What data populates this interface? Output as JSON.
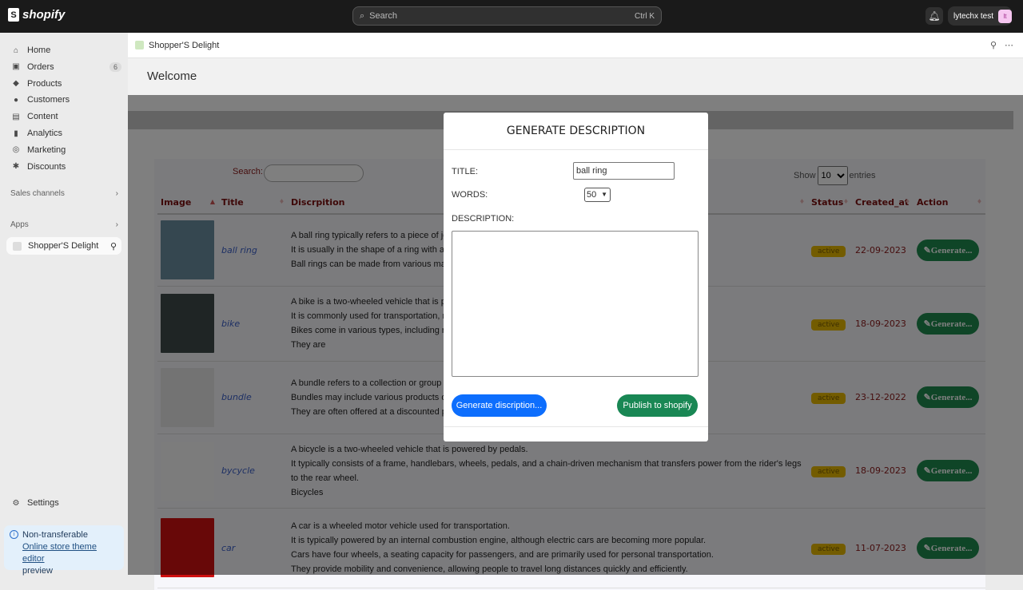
{
  "topbar": {
    "brand": "shopify",
    "search_placeholder": "Search",
    "search_shortcut": "Ctrl K",
    "user_name": "lytechx test",
    "user_initials": "lt"
  },
  "sidebar": {
    "items": [
      {
        "label": "Home",
        "icon": "home-icon",
        "glyph": "⌂"
      },
      {
        "label": "Orders",
        "icon": "orders-icon",
        "glyph": "▣",
        "badge": "6"
      },
      {
        "label": "Products",
        "icon": "tag-icon",
        "glyph": "◆"
      },
      {
        "label": "Customers",
        "icon": "person-icon",
        "glyph": "●"
      },
      {
        "label": "Content",
        "icon": "content-icon",
        "glyph": "▤"
      },
      {
        "label": "Analytics",
        "icon": "bar-chart-icon",
        "glyph": "▮"
      },
      {
        "label": "Marketing",
        "icon": "target-icon",
        "glyph": "◎"
      },
      {
        "label": "Discounts",
        "icon": "discount-icon",
        "glyph": "✱"
      }
    ],
    "sales_channels": "Sales channels",
    "apps": "Apps",
    "app_item": "Shopper'S Delight",
    "settings": "Settings",
    "notice": {
      "title": "Non-transferable",
      "link": "Online store theme editor",
      "suffix": "preview"
    }
  },
  "app": {
    "name": "Shopper'S Delight",
    "page_title": "Welcome"
  },
  "table": {
    "search_label": "Search:",
    "show_label": "Show",
    "entries_label": "entries",
    "page_size": "10",
    "headers": [
      "Image",
      "Title",
      "Discrpition",
      "Status",
      "Created_at",
      "Action"
    ],
    "rows": [
      {
        "title": "ball ring",
        "desc": [
          "A ball ring typically refers to a piece of jewelry.",
          "It is usually in the shape of a ring with a ball.",
          "Ball rings can be made from various materials."
        ],
        "status": "active",
        "date": "22-09-2023",
        "action": "Generate...",
        "thumb": "#6a8fa0"
      },
      {
        "title": "bike",
        "desc": [
          "A bike is a two-wheeled vehicle that is powered.",
          "It is commonly used for transportation, recreation.",
          "Bikes come in various types, including road bikes.",
          "They are"
        ],
        "status": "active",
        "date": "18-09-2023",
        "action": "Generate...",
        "thumb": "#3f4a4a"
      },
      {
        "title": "bundle",
        "desc": [
          "A bundle refers to a collection or group of items.",
          "Bundles may include various products or services.",
          "They are often offered at a discounted price."
        ],
        "status": "active",
        "date": "23-12-2022",
        "action": "Generate...",
        "thumb": "#e6e6e6"
      },
      {
        "title": "bycycle",
        "desc": [
          "A bicycle is a two-wheeled vehicle that is powered by pedals.",
          "It typically consists of a frame, handlebars, wheels, pedals, and a chain-driven mechanism that transfers power from the rider's legs to the rear wheel.",
          "Bicycles"
        ],
        "status": "active",
        "date": "18-09-2023",
        "action": "Generate...",
        "thumb": "#f8f8f8"
      },
      {
        "title": "car",
        "desc": [
          "A car is a wheeled motor vehicle used for transportation.",
          "It is typically powered by an internal combustion engine, although electric cars are becoming more popular.",
          "Cars have four wheels, a seating capacity for passengers, and are primarily used for personal transportation.",
          "They provide mobility and convenience, allowing people to travel long distances quickly and efficiently."
        ],
        "status": "active",
        "date": "11-07-2023",
        "action": "Generate...",
        "thumb": "#d01010"
      }
    ]
  },
  "modal": {
    "title": "GENERATE DESCRIPTION",
    "title_label": "TITLE:",
    "title_value": "ball ring",
    "words_label": "WORDS:",
    "words_value": "50",
    "description_label": "DESCRIPTION:",
    "description_value": "",
    "generate_label": "Generate discription...",
    "publish_label": "Publish to shopify"
  }
}
